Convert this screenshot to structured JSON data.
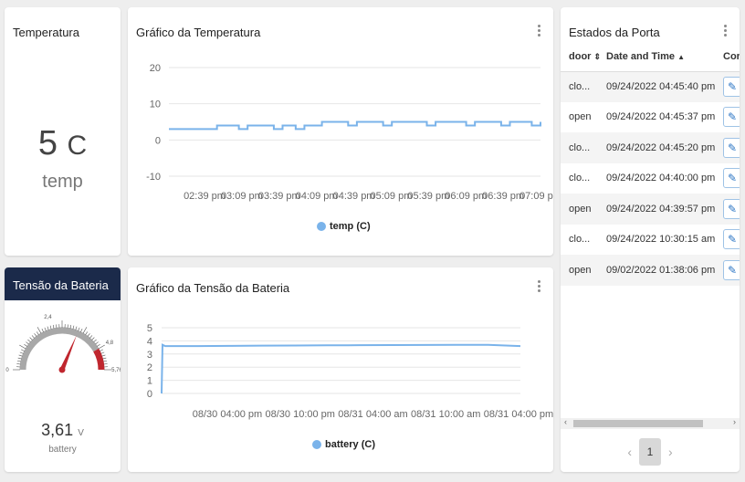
{
  "temp_card": {
    "title": "Temperatura",
    "value": "5",
    "unit": "C",
    "label": "temp"
  },
  "temp_chart": {
    "title": "Gráfico da Temperatura",
    "legend": "temp (C)",
    "series_color": "#7ab3ea",
    "y_ticks": [
      "20",
      "10",
      "0",
      "-10"
    ],
    "x_ticks": [
      "02:39 pm",
      "03:09 pm",
      "03:39 pm",
      "04:09 pm",
      "04:39 pm",
      "05:09 pm",
      "05:39 pm",
      "06:09 pm",
      "06:39 pm",
      "07:09 pm"
    ]
  },
  "battery_card": {
    "title": "Tensão da Bateria",
    "value": "3,61",
    "unit": "V",
    "label": "battery",
    "gauge_labels": [
      "0",
      "2,4",
      "4,8",
      "5,76"
    ],
    "header_color": "#1b2a4a",
    "danger_color": "#c0262e"
  },
  "battery_chart": {
    "title": "Gráfico da Tensão da Bateria",
    "legend": "battery (C)",
    "y_ticks": [
      "5",
      "4",
      "3",
      "2",
      "1",
      "0"
    ],
    "x_ticks": [
      "08/30 04:00 pm",
      "08/30 10:00 pm",
      "08/31 04:00 am",
      "08/31 10:00 am",
      "08/31 04:00 pm"
    ]
  },
  "door_table": {
    "title": "Estados da Porta",
    "columns": [
      "door",
      "Date and Time",
      "Cor"
    ],
    "rows": [
      {
        "door": "clo...",
        "datetime": "09/24/2022 04:45:40 pm"
      },
      {
        "door": "open",
        "datetime": "09/24/2022 04:45:37 pm"
      },
      {
        "door": "clo...",
        "datetime": "09/24/2022 04:45:20 pm"
      },
      {
        "door": "clo...",
        "datetime": "09/24/2022 04:40:00 pm"
      },
      {
        "door": "open",
        "datetime": "09/24/2022 04:39:57 pm"
      },
      {
        "door": "clo...",
        "datetime": "09/24/2022 10:30:15 am"
      },
      {
        "door": "open",
        "datetime": "09/02/2022 01:38:06 pm"
      }
    ],
    "pagination": {
      "current": "1"
    }
  },
  "chart_data": [
    {
      "type": "line",
      "title": "Gráfico da Temperatura",
      "series": [
        {
          "name": "temp (C)",
          "values": [
            3,
            3,
            3,
            3,
            3,
            3,
            3,
            3,
            3,
            3,
            3,
            4,
            4,
            4,
            4,
            4,
            3,
            3,
            4,
            4,
            4,
            4,
            4,
            4,
            3,
            3,
            4,
            4,
            4,
            3,
            3,
            4,
            4,
            4,
            4,
            5,
            5,
            5,
            5,
            5,
            5,
            4,
            4,
            5,
            5,
            5,
            5,
            5,
            5,
            4,
            4,
            5,
            5,
            5,
            5,
            5,
            5,
            5,
            5,
            4,
            4,
            5,
            5,
            5,
            5,
            5,
            5,
            5,
            4,
            4,
            5,
            5,
            5,
            5,
            5,
            5,
            4,
            4,
            5,
            5,
            5,
            5,
            5,
            4,
            4,
            5
          ]
        }
      ],
      "x_ticks": [
        "02:39 pm",
        "03:09 pm",
        "03:39 pm",
        "04:09 pm",
        "04:39 pm",
        "05:09 pm",
        "05:39 pm",
        "06:09 pm",
        "06:39 pm",
        "07:09 pm"
      ],
      "ylim": [
        -10,
        20
      ]
    },
    {
      "type": "line",
      "title": "Gráfico da Tensão da Bateria",
      "series": [
        {
          "name": "battery (C)",
          "values": [
            0,
            3.7,
            3.6,
            3.6,
            3.62,
            3.64,
            3.65,
            3.66,
            3.67,
            3.68,
            3.69,
            3.7,
            3.7,
            3.6
          ]
        }
      ],
      "x_ticks": [
        "08/30 04:00 pm",
        "08/30 10:00 pm",
        "08/31 04:00 am",
        "08/31 10:00 am",
        "08/31 04:00 pm"
      ],
      "ylim": [
        0,
        5
      ]
    }
  ]
}
